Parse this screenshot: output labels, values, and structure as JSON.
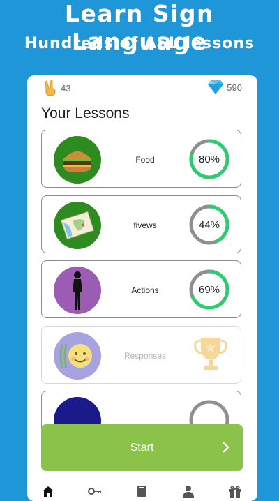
{
  "header": {
    "title": "Learn Sign Language",
    "subtitle": "Hundreds of ASL lessons"
  },
  "stats": {
    "hands": "43",
    "gems": "590"
  },
  "section_title": "Your Lessons",
  "lessons": [
    {
      "name": "Food",
      "progress_label": "80%",
      "progress": 0.8,
      "avatar_color": "#2e8b1f"
    },
    {
      "name": "fivews",
      "progress_label": "44%",
      "progress": 0.44,
      "avatar_color": "#2e8b1f"
    },
    {
      "name": "Actions",
      "progress_label": "69%",
      "progress": 0.69,
      "avatar_color": "#9c5cb4"
    },
    {
      "name": "Responses",
      "avatar_color": "#a7a3e0",
      "status": "completed"
    },
    {
      "name": "",
      "avatar_color": "#1a1a8a"
    }
  ],
  "start_button": {
    "label": "Start"
  },
  "nav": {
    "items": [
      "home-icon",
      "key-icon",
      "book-icon",
      "profile-icon",
      "gift-icon"
    ]
  },
  "colors": {
    "background": "#1e96d8",
    "progress_fill": "#2ecc71",
    "progress_track": "#8f8f8f",
    "start_button": "#8bc34a"
  }
}
